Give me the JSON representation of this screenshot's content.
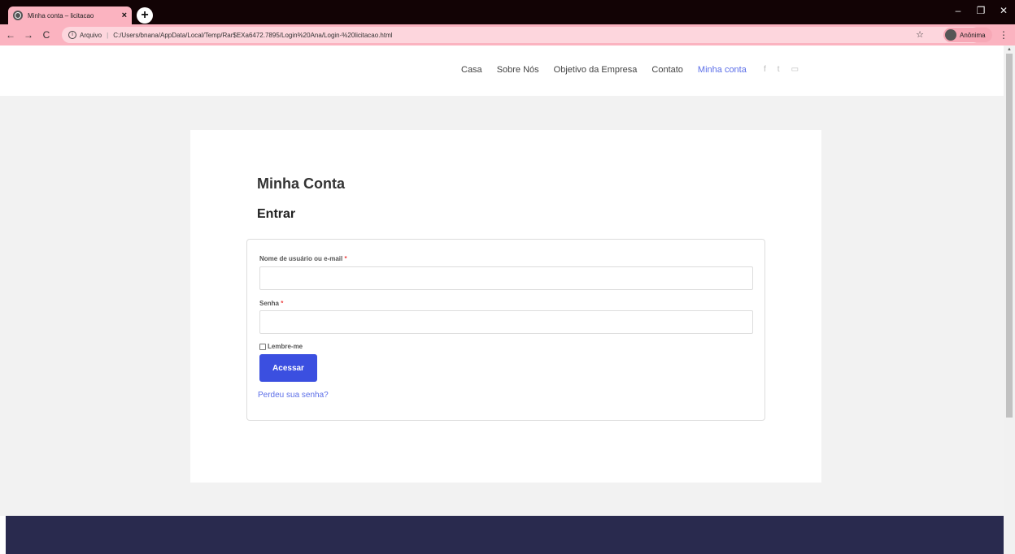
{
  "browser": {
    "tab_title": "Minha conta – licitacao",
    "tab_close": "×",
    "new_tab": "+",
    "url_scheme_label": "Arquivo",
    "url": "C:/Users/bnana/AppData/Local/Temp/Rar$EXa6472.7895/Login%20Ana/Login-%20licitacao.html",
    "profile_label": "Anônima",
    "controls": {
      "minimize": "–",
      "restore": "❐",
      "close": "✕"
    },
    "nav": {
      "back": "←",
      "forward": "→",
      "reload": "C"
    },
    "star": "☆",
    "menu": "⋮",
    "info": "i",
    "sep": "|"
  },
  "site": {
    "nav": [
      "Casa",
      "Sobre Nós",
      "Objetivo da Empresa",
      "Contato",
      "Minha conta"
    ],
    "active_nav": "Minha conta",
    "social": [
      "f",
      "t",
      "▭"
    ]
  },
  "page": {
    "title": "Minha Conta",
    "subtitle": "Entrar",
    "username_label": "Nome de usuário ou e-mail",
    "password_label": "Senha",
    "required_mark": "*",
    "remember_label": "Lembre-me",
    "submit_label": "Acessar",
    "lost_password": "Perdeu sua senha?"
  },
  "colors": {
    "accent": "#3b4fe0",
    "link": "#5b6ee8",
    "footer": "#292a4e",
    "browser_bar": "#fbb3c0"
  }
}
